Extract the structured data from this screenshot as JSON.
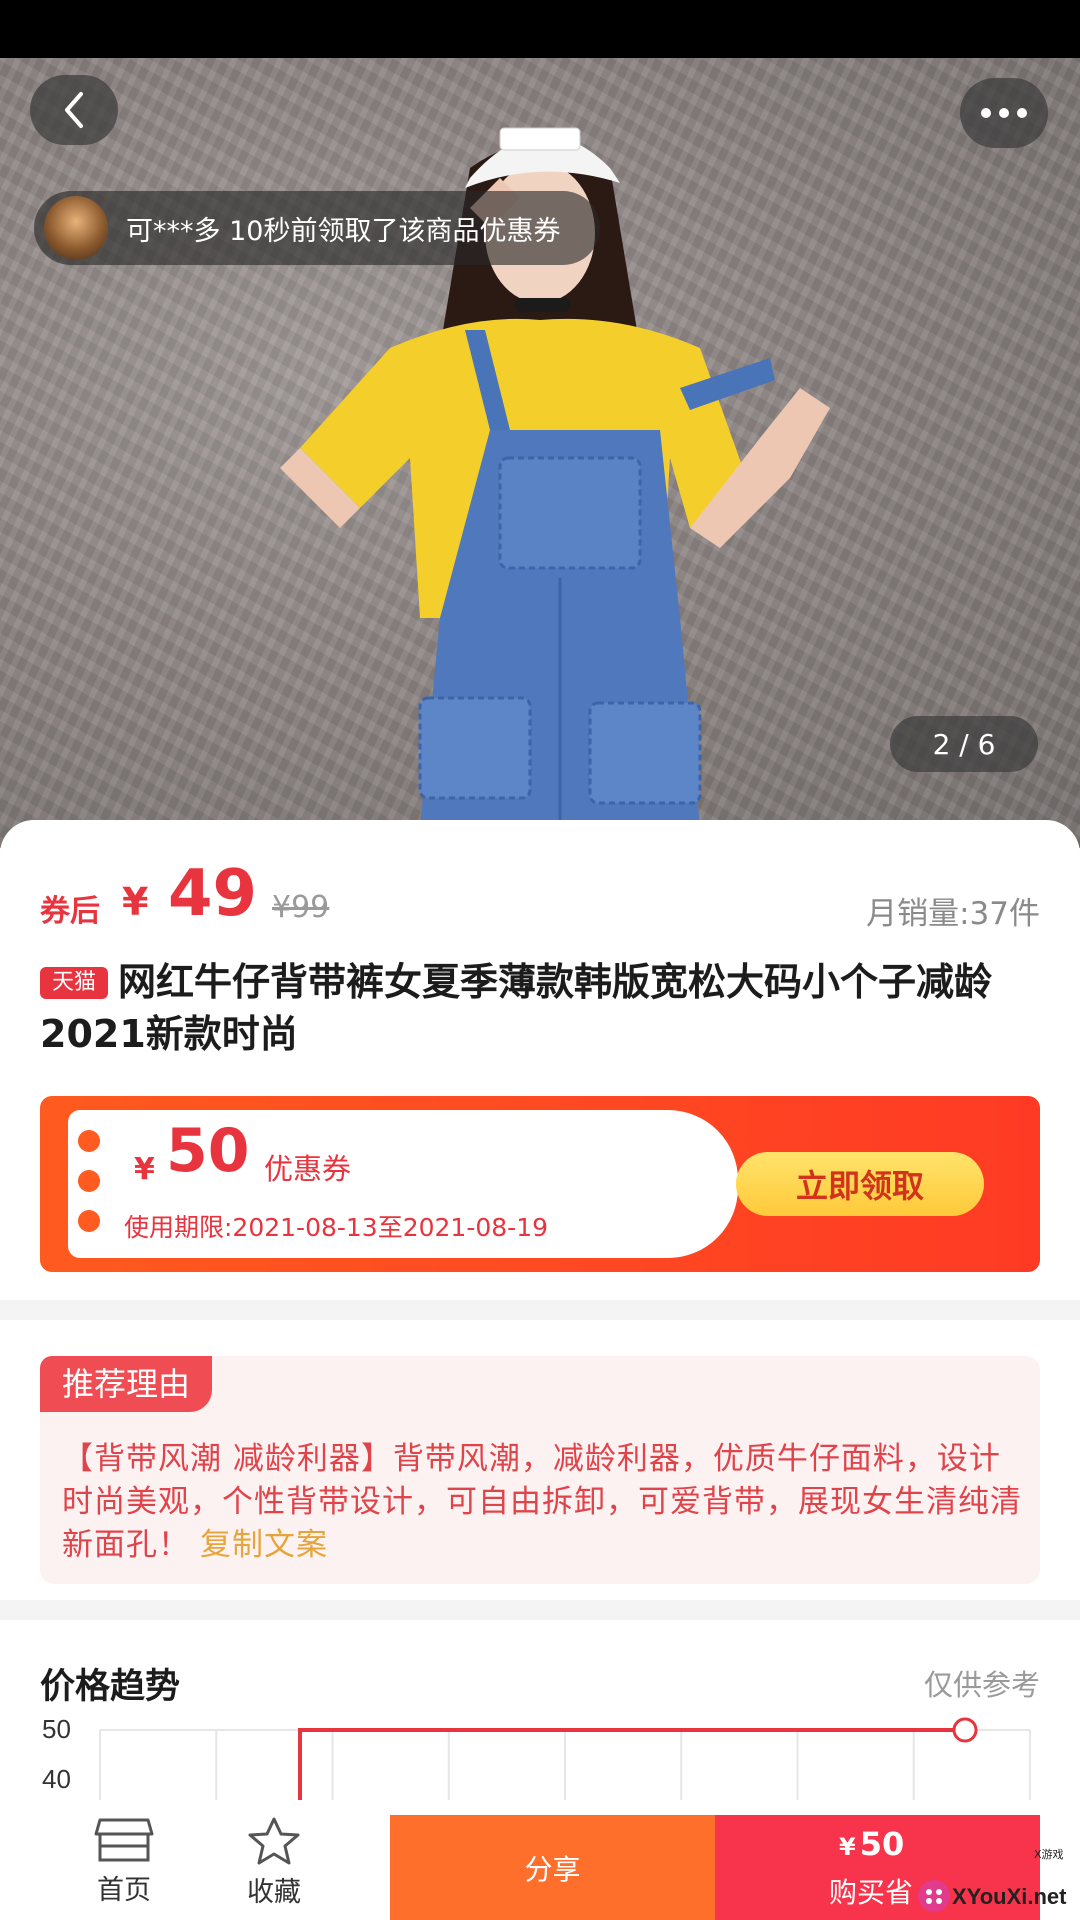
{
  "colors": {
    "accent": "#e8343e",
    "share": "#ff6f2c",
    "buy": "#f7344b",
    "coupon_button": "#ffd54a"
  },
  "gallery": {
    "current": 2,
    "total": 6,
    "pager_text": "2 / 6"
  },
  "notice": {
    "text": "可***多 10秒前领取了该商品优惠券"
  },
  "price": {
    "after_coupon_label": "券后",
    "currency": "¥",
    "value": "49",
    "original": "¥99",
    "monthly_sales": "月销量:37件"
  },
  "product": {
    "platform_tag": "天猫",
    "title": "网红牛仔背带裤女夏季薄款韩版宽松大码小个子减龄2021新款时尚"
  },
  "coupon": {
    "currency": "¥",
    "amount": "50",
    "label": "优惠券",
    "validity": "使用期限:2021-08-13至2021-08-19",
    "button": "立即领取"
  },
  "recommend": {
    "tag": "推荐理由",
    "text": "【背带风潮 减龄利器】背带风潮，减龄利器，优质牛仔面料，设计时尚美观，个性背带设计，可自由拆卸，可爱背带，展现女生清纯清新面孔！",
    "copy_link": "复制文案"
  },
  "trend": {
    "title": "价格趋势",
    "note": "仅供参考",
    "y_ticks": [
      "50",
      "40"
    ]
  },
  "chart_data": {
    "type": "line",
    "title": "价格趋势",
    "y_tick_labels": [
      "50",
      "40"
    ],
    "series": [
      {
        "values": [
          40,
          50,
          50,
          50,
          50,
          50
        ]
      }
    ],
    "grid": true
  },
  "bottom_nav": {
    "home": "首页",
    "favorite": "收藏",
    "share": "分享",
    "buy_currency": "¥",
    "buy_amount": "50",
    "buy_label": "购买省"
  },
  "watermark": {
    "text": "XYouXi.net",
    "small_text": "X游戏"
  }
}
